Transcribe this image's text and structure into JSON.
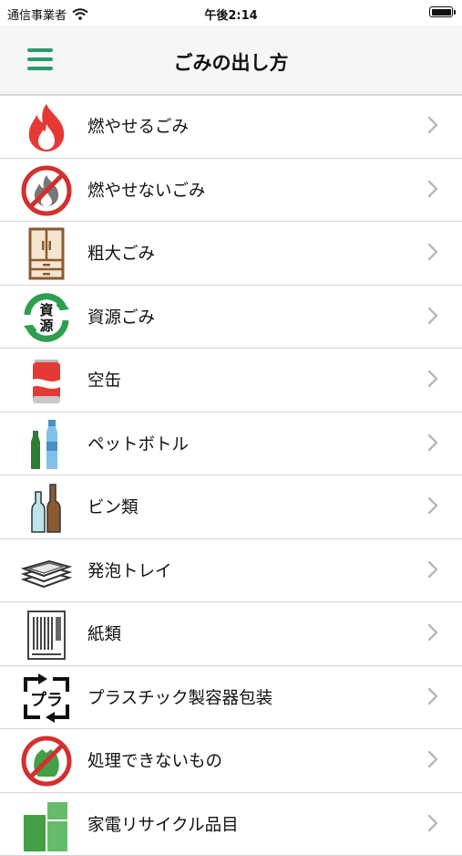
{
  "status_bar": {
    "carrier": "通信事業者",
    "time": "午後2:14"
  },
  "nav": {
    "title": "ごみの出し方"
  },
  "items": [
    {
      "label": "燃やせるごみ",
      "icon": "fire-icon"
    },
    {
      "label": "燃やせないごみ",
      "icon": "no-fire-icon"
    },
    {
      "label": "粗大ごみ",
      "icon": "cabinet-icon"
    },
    {
      "label": "資源ごみ",
      "icon": "recycle-resource-icon"
    },
    {
      "label": "空缶",
      "icon": "can-icon"
    },
    {
      "label": "ペットボトル",
      "icon": "pet-bottle-icon"
    },
    {
      "label": "ビン類",
      "icon": "glass-bottle-icon"
    },
    {
      "label": "発泡トレイ",
      "icon": "foam-tray-icon"
    },
    {
      "label": "紙類",
      "icon": "paper-icon"
    },
    {
      "label": "プラスチック製容器包装",
      "icon": "plastic-mark-icon"
    },
    {
      "label": "処理できないもの",
      "icon": "prohibited-bag-icon"
    },
    {
      "label": "家電リサイクル品目",
      "icon": "appliance-icon"
    }
  ],
  "colors": {
    "accent": "#2a9c6a",
    "nav_bg": "#f6f6f6",
    "divider": "#d4d4d4"
  }
}
